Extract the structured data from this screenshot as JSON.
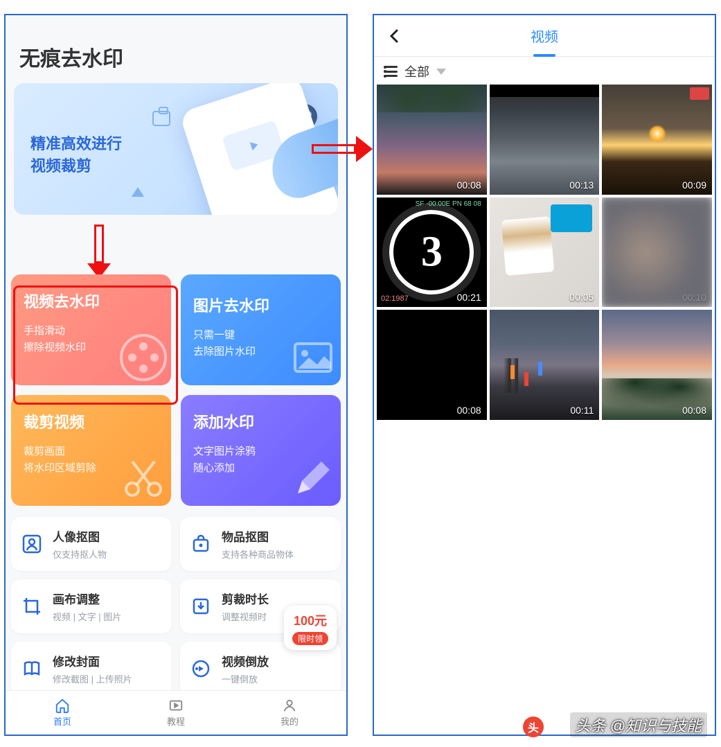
{
  "left": {
    "title": "无痕去水印",
    "banner": {
      "line1": "精准高效进行",
      "line2": "视频裁剪"
    },
    "cards": {
      "video": {
        "title": "视频去水印",
        "sub1": "手指滑动",
        "sub2": "擦除视频水印"
      },
      "image": {
        "title": "图片去水印",
        "sub1": "只需一键",
        "sub2": "去除图片水印"
      },
      "crop": {
        "title": "裁剪视频",
        "sub1": "裁剪画面",
        "sub2": "将水印区域剪除"
      },
      "addwm": {
        "title": "添加水印",
        "sub1": "文字图片涂鸦",
        "sub2": "随心添加"
      }
    },
    "features": [
      {
        "title": "人像抠图",
        "sub": "仅支持抠人物"
      },
      {
        "title": "物品抠图",
        "sub": "支持各种商品物体"
      },
      {
        "title": "画布调整",
        "sub": "视频 | 文字 | 图片"
      },
      {
        "title": "剪裁时长",
        "sub": "调整视频时"
      },
      {
        "title": "修改封面",
        "sub": "修改截图 | 上传照片"
      },
      {
        "title": "视频倒放",
        "sub": "一键倒放"
      }
    ],
    "promo": {
      "amount": "100元",
      "pill": "限时领"
    },
    "tabs": {
      "home": "首页",
      "tutorial": "教程",
      "mine": "我的"
    }
  },
  "right": {
    "header_title": "视频",
    "filter_label": "全部",
    "thumbs": [
      {
        "duration": "00:08"
      },
      {
        "duration": "00:13"
      },
      {
        "duration": "00:09"
      },
      {
        "duration": "00:21",
        "tc_left": "02:1987",
        "readout": "SF\n-00:00E\nPN 68 08"
      },
      {
        "duration": "00:05"
      },
      {
        "duration": "00:10"
      },
      {
        "duration": "00:08"
      },
      {
        "duration": "00:11"
      },
      {
        "duration": "00:08"
      }
    ]
  },
  "watermark": {
    "text": "头条 @知识与技能"
  }
}
